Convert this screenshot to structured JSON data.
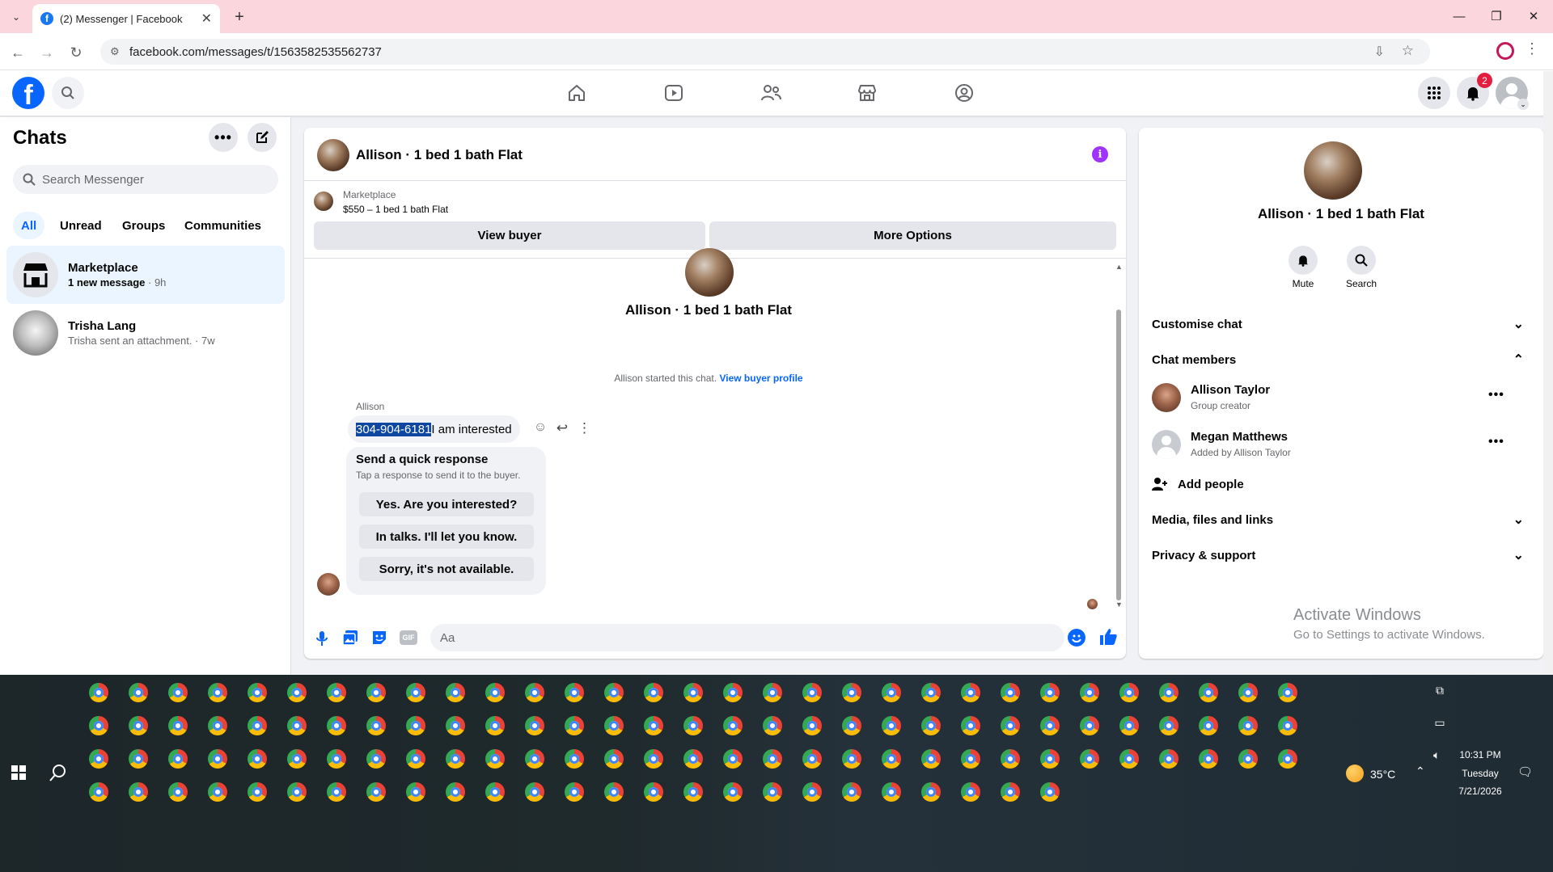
{
  "browser": {
    "tab_title": "(2) Messenger | Facebook",
    "url": "facebook.com/messages/t/1563582535562737",
    "fb_letter": "f"
  },
  "fb": {
    "notification_count": "2"
  },
  "left": {
    "title": "Chats",
    "search_placeholder": "Search Messenger",
    "filters": [
      "All",
      "Unread",
      "Groups",
      "Communities"
    ],
    "chats": [
      {
        "name": "Marketplace",
        "preview": "1 new message",
        "time": " · 9h"
      },
      {
        "name": "Trisha Lang",
        "preview": "Trisha sent an attachment. · 7w",
        "time": ""
      }
    ]
  },
  "convo": {
    "title": "Allison · 1 bed 1 bath Flat",
    "marketplace_label": "Marketplace",
    "listing": "$550 – 1 bed 1 bath Flat",
    "view_buyer": "View buyer",
    "more_options": "More Options",
    "profile_name": "Allison · 1 bed 1 bath Flat",
    "started_text": "Allison started this chat.",
    "view_buyer_profile": "View buyer profile",
    "sender": "Allison",
    "msg_phone": "304-904-6181",
    "msg_text": " I am interested",
    "quick_title": "Send a quick response",
    "quick_sub": "Tap a response to send it to the buyer.",
    "quick_replies": [
      "Yes. Are you interested?",
      "In talks. I'll let you know.",
      "Sorry, it's not available."
    ],
    "composer_placeholder": "Aa"
  },
  "right": {
    "name": "Allison · 1 bed 1 bath Flat",
    "mute": "Mute",
    "search": "Search",
    "customise": "Customise chat",
    "members_title": "Chat members",
    "members": [
      {
        "name": "Allison Taylor",
        "role": "Group creator"
      },
      {
        "name": "Megan Matthews",
        "role": "Added by Allison Taylor"
      }
    ],
    "add_people": "Add people",
    "media": "Media, files and links",
    "privacy": "Privacy & support",
    "activate_title": "Activate Windows",
    "activate_sub": "Go to Settings to activate Windows."
  },
  "taskbar": {
    "temperature": "35°C",
    "time": "10:31 PM",
    "day": "Tuesday",
    "date": "7/21/2026"
  },
  "colors": {
    "fb_blue": "#0866ff",
    "tab_strip": "#fbd6dd",
    "selected_chat": "#ebf5ff",
    "info_purple": "#a033ff"
  }
}
